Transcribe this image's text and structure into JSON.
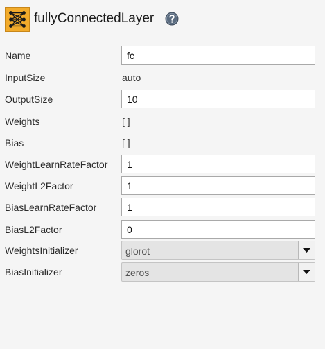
{
  "header": {
    "title": "fullyConnectedLayer",
    "layer_icon": "fully-connected-layer-icon",
    "help_icon": "question-mark-icon"
  },
  "properties": [
    {
      "label": "Name",
      "kind": "text",
      "value": "fc"
    },
    {
      "label": "InputSize",
      "kind": "static",
      "value": "auto"
    },
    {
      "label": "OutputSize",
      "kind": "text",
      "value": "10"
    },
    {
      "label": "Weights",
      "kind": "static",
      "value": "[ ]"
    },
    {
      "label": "Bias",
      "kind": "static",
      "value": "[ ]"
    },
    {
      "label": "WeightLearnRateFactor",
      "kind": "text",
      "value": "1"
    },
    {
      "label": "WeightL2Factor",
      "kind": "text",
      "value": "1"
    },
    {
      "label": "BiasLearnRateFactor",
      "kind": "text",
      "value": "1"
    },
    {
      "label": "BiasL2Factor",
      "kind": "text",
      "value": "0"
    },
    {
      "label": "WeightsInitializer",
      "kind": "dropdown",
      "value": "glorot"
    },
    {
      "label": "BiasInitializer",
      "kind": "dropdown",
      "value": "zeros"
    }
  ],
  "colors": {
    "panel_background": "#f5f5f5",
    "layer_icon_fill": "#f2ab2b",
    "help_icon_fill": "#5a6b7f",
    "dropdown_fill": "#e4e4e4"
  }
}
